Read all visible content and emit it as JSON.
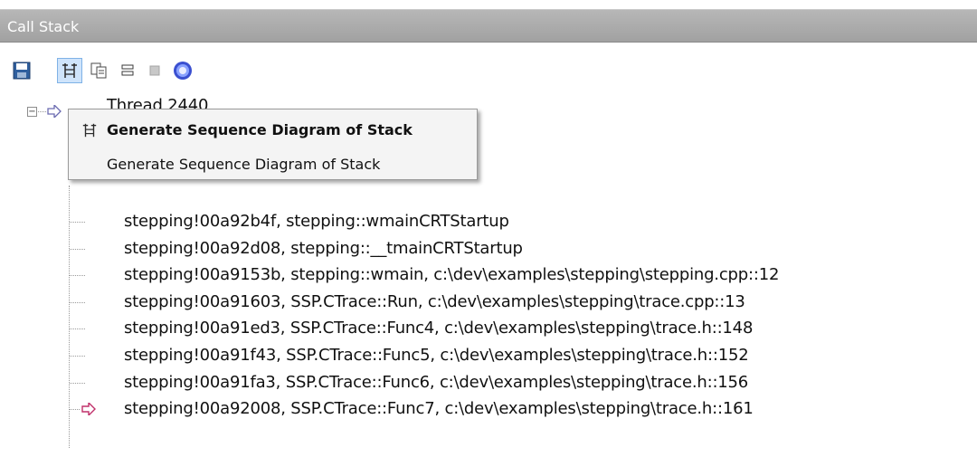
{
  "window": {
    "title": "Call Stack"
  },
  "toolbar": {
    "buttons": [
      {
        "name": "save-icon"
      },
      {
        "name": "sequence-diagram-icon",
        "active": true
      },
      {
        "name": "copy-icon"
      },
      {
        "name": "collapse-icon"
      },
      {
        "name": "stop-icon"
      },
      {
        "name": "help-icon"
      }
    ]
  },
  "tree": {
    "thread_label": "Thread 2440",
    "frames": [
      {
        "text": "stepping!00a92b4f, stepping::wmainCRTStartup",
        "current": false
      },
      {
        "text": "stepping!00a92d08, stepping::__tmainCRTStartup",
        "current": false
      },
      {
        "text": "stepping!00a9153b, stepping::wmain, c:\\dev\\examples\\stepping\\stepping.cpp::12",
        "current": false
      },
      {
        "text": "stepping!00a91603, SSP.CTrace::Run, c:\\dev\\examples\\stepping\\trace.cpp::13",
        "current": false
      },
      {
        "text": "stepping!00a91ed3, SSP.CTrace::Func4, c:\\dev\\examples\\stepping\\trace.h::148",
        "current": false
      },
      {
        "text": "stepping!00a91f43, SSP.CTrace::Func5, c:\\dev\\examples\\stepping\\trace.h::152",
        "current": false
      },
      {
        "text": "stepping!00a91fa3, SSP.CTrace::Func6, c:\\dev\\examples\\stepping\\trace.h::156",
        "current": false
      },
      {
        "text": "stepping!00a92008, SSP.CTrace::Func7, c:\\dev\\examples\\stepping\\trace.h::161",
        "current": true
      }
    ]
  },
  "tooltip": {
    "title": "Generate Sequence Diagram of Stack",
    "description": "Generate Sequence Diagram of Stack"
  },
  "colors": {
    "titlebar": "#a9a9a9",
    "current_arrow": "#c0306a",
    "toolbar_active": "#cfe4fb"
  }
}
